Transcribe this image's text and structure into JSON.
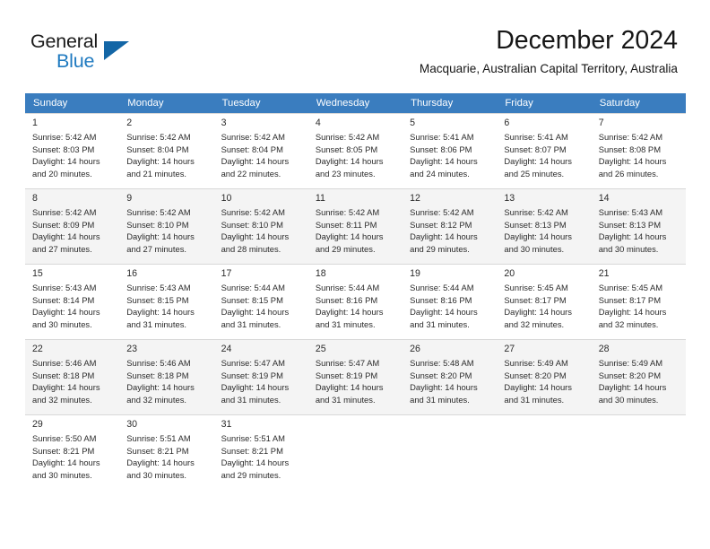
{
  "brand": {
    "word_one": "General",
    "word_two": "Blue",
    "logo_icon": "triangle-flag-icon",
    "accent_color": "#1f7ac0",
    "triangle_color": "#1366a6"
  },
  "header": {
    "month_title": "December 2024",
    "location": "Macquarie, Australian Capital Territory, Australia"
  },
  "theme": {
    "header_row_bg": "#3a7dbf",
    "header_row_text": "#ffffff",
    "alt_row_bg": "#f4f4f4",
    "grid_line": "#d8d8d8"
  },
  "weekday_headers": [
    "Sunday",
    "Monday",
    "Tuesday",
    "Wednesday",
    "Thursday",
    "Friday",
    "Saturday"
  ],
  "weeks": [
    {
      "shaded": false,
      "days": [
        {
          "day": "1",
          "sunrise": "Sunrise: 5:42 AM",
          "sunset": "Sunset: 8:03 PM",
          "daylight_line1": "Daylight: 14 hours",
          "daylight_line2": "and 20 minutes."
        },
        {
          "day": "2",
          "sunrise": "Sunrise: 5:42 AM",
          "sunset": "Sunset: 8:04 PM",
          "daylight_line1": "Daylight: 14 hours",
          "daylight_line2": "and 21 minutes."
        },
        {
          "day": "3",
          "sunrise": "Sunrise: 5:42 AM",
          "sunset": "Sunset: 8:04 PM",
          "daylight_line1": "Daylight: 14 hours",
          "daylight_line2": "and 22 minutes."
        },
        {
          "day": "4",
          "sunrise": "Sunrise: 5:42 AM",
          "sunset": "Sunset: 8:05 PM",
          "daylight_line1": "Daylight: 14 hours",
          "daylight_line2": "and 23 minutes."
        },
        {
          "day": "5",
          "sunrise": "Sunrise: 5:41 AM",
          "sunset": "Sunset: 8:06 PM",
          "daylight_line1": "Daylight: 14 hours",
          "daylight_line2": "and 24 minutes."
        },
        {
          "day": "6",
          "sunrise": "Sunrise: 5:41 AM",
          "sunset": "Sunset: 8:07 PM",
          "daylight_line1": "Daylight: 14 hours",
          "daylight_line2": "and 25 minutes."
        },
        {
          "day": "7",
          "sunrise": "Sunrise: 5:42 AM",
          "sunset": "Sunset: 8:08 PM",
          "daylight_line1": "Daylight: 14 hours",
          "daylight_line2": "and 26 minutes."
        }
      ]
    },
    {
      "shaded": true,
      "days": [
        {
          "day": "8",
          "sunrise": "Sunrise: 5:42 AM",
          "sunset": "Sunset: 8:09 PM",
          "daylight_line1": "Daylight: 14 hours",
          "daylight_line2": "and 27 minutes."
        },
        {
          "day": "9",
          "sunrise": "Sunrise: 5:42 AM",
          "sunset": "Sunset: 8:10 PM",
          "daylight_line1": "Daylight: 14 hours",
          "daylight_line2": "and 27 minutes."
        },
        {
          "day": "10",
          "sunrise": "Sunrise: 5:42 AM",
          "sunset": "Sunset: 8:10 PM",
          "daylight_line1": "Daylight: 14 hours",
          "daylight_line2": "and 28 minutes."
        },
        {
          "day": "11",
          "sunrise": "Sunrise: 5:42 AM",
          "sunset": "Sunset: 8:11 PM",
          "daylight_line1": "Daylight: 14 hours",
          "daylight_line2": "and 29 minutes."
        },
        {
          "day": "12",
          "sunrise": "Sunrise: 5:42 AM",
          "sunset": "Sunset: 8:12 PM",
          "daylight_line1": "Daylight: 14 hours",
          "daylight_line2": "and 29 minutes."
        },
        {
          "day": "13",
          "sunrise": "Sunrise: 5:42 AM",
          "sunset": "Sunset: 8:13 PM",
          "daylight_line1": "Daylight: 14 hours",
          "daylight_line2": "and 30 minutes."
        },
        {
          "day": "14",
          "sunrise": "Sunrise: 5:43 AM",
          "sunset": "Sunset: 8:13 PM",
          "daylight_line1": "Daylight: 14 hours",
          "daylight_line2": "and 30 minutes."
        }
      ]
    },
    {
      "shaded": false,
      "days": [
        {
          "day": "15",
          "sunrise": "Sunrise: 5:43 AM",
          "sunset": "Sunset: 8:14 PM",
          "daylight_line1": "Daylight: 14 hours",
          "daylight_line2": "and 30 minutes."
        },
        {
          "day": "16",
          "sunrise": "Sunrise: 5:43 AM",
          "sunset": "Sunset: 8:15 PM",
          "daylight_line1": "Daylight: 14 hours",
          "daylight_line2": "and 31 minutes."
        },
        {
          "day": "17",
          "sunrise": "Sunrise: 5:44 AM",
          "sunset": "Sunset: 8:15 PM",
          "daylight_line1": "Daylight: 14 hours",
          "daylight_line2": "and 31 minutes."
        },
        {
          "day": "18",
          "sunrise": "Sunrise: 5:44 AM",
          "sunset": "Sunset: 8:16 PM",
          "daylight_line1": "Daylight: 14 hours",
          "daylight_line2": "and 31 minutes."
        },
        {
          "day": "19",
          "sunrise": "Sunrise: 5:44 AM",
          "sunset": "Sunset: 8:16 PM",
          "daylight_line1": "Daylight: 14 hours",
          "daylight_line2": "and 31 minutes."
        },
        {
          "day": "20",
          "sunrise": "Sunrise: 5:45 AM",
          "sunset": "Sunset: 8:17 PM",
          "daylight_line1": "Daylight: 14 hours",
          "daylight_line2": "and 32 minutes."
        },
        {
          "day": "21",
          "sunrise": "Sunrise: 5:45 AM",
          "sunset": "Sunset: 8:17 PM",
          "daylight_line1": "Daylight: 14 hours",
          "daylight_line2": "and 32 minutes."
        }
      ]
    },
    {
      "shaded": true,
      "days": [
        {
          "day": "22",
          "sunrise": "Sunrise: 5:46 AM",
          "sunset": "Sunset: 8:18 PM",
          "daylight_line1": "Daylight: 14 hours",
          "daylight_line2": "and 32 minutes."
        },
        {
          "day": "23",
          "sunrise": "Sunrise: 5:46 AM",
          "sunset": "Sunset: 8:18 PM",
          "daylight_line1": "Daylight: 14 hours",
          "daylight_line2": "and 32 minutes."
        },
        {
          "day": "24",
          "sunrise": "Sunrise: 5:47 AM",
          "sunset": "Sunset: 8:19 PM",
          "daylight_line1": "Daylight: 14 hours",
          "daylight_line2": "and 31 minutes."
        },
        {
          "day": "25",
          "sunrise": "Sunrise: 5:47 AM",
          "sunset": "Sunset: 8:19 PM",
          "daylight_line1": "Daylight: 14 hours",
          "daylight_line2": "and 31 minutes."
        },
        {
          "day": "26",
          "sunrise": "Sunrise: 5:48 AM",
          "sunset": "Sunset: 8:20 PM",
          "daylight_line1": "Daylight: 14 hours",
          "daylight_line2": "and 31 minutes."
        },
        {
          "day": "27",
          "sunrise": "Sunrise: 5:49 AM",
          "sunset": "Sunset: 8:20 PM",
          "daylight_line1": "Daylight: 14 hours",
          "daylight_line2": "and 31 minutes."
        },
        {
          "day": "28",
          "sunrise": "Sunrise: 5:49 AM",
          "sunset": "Sunset: 8:20 PM",
          "daylight_line1": "Daylight: 14 hours",
          "daylight_line2": "and 30 minutes."
        }
      ]
    },
    {
      "shaded": false,
      "days": [
        {
          "day": "29",
          "sunrise": "Sunrise: 5:50 AM",
          "sunset": "Sunset: 8:21 PM",
          "daylight_line1": "Daylight: 14 hours",
          "daylight_line2": "and 30 minutes."
        },
        {
          "day": "30",
          "sunrise": "Sunrise: 5:51 AM",
          "sunset": "Sunset: 8:21 PM",
          "daylight_line1": "Daylight: 14 hours",
          "daylight_line2": "and 30 minutes."
        },
        {
          "day": "31",
          "sunrise": "Sunrise: 5:51 AM",
          "sunset": "Sunset: 8:21 PM",
          "daylight_line1": "Daylight: 14 hours",
          "daylight_line2": "and 29 minutes."
        },
        null,
        null,
        null,
        null
      ]
    }
  ]
}
